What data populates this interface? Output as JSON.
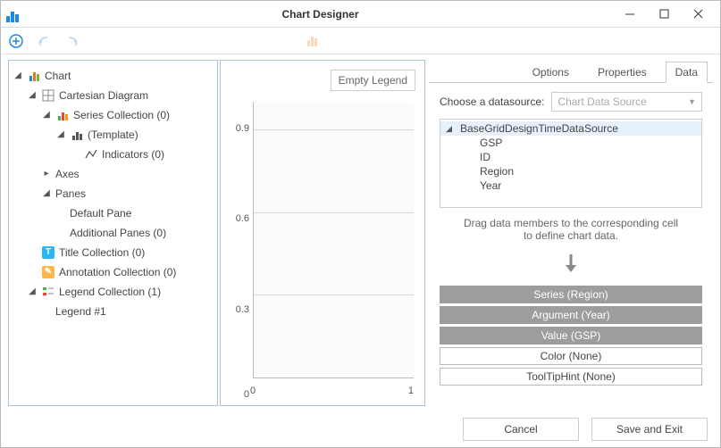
{
  "window": {
    "title": "Chart Designer"
  },
  "tree": {
    "chart": "Chart",
    "cartesian": "Cartesian Diagram",
    "series_collection": "Series Collection (0)",
    "template": "(Template)",
    "indicators": "Indicators (0)",
    "axes": "Axes",
    "panes": "Panes",
    "default_pane": "Default Pane",
    "additional_panes": "Additional Panes (0)",
    "title_collection": "Title Collection (0)",
    "annotation_collection": "Annotation Collection (0)",
    "legend_collection": "Legend Collection (1)",
    "legend1": "Legend #1"
  },
  "preview": {
    "legend": "Empty Legend"
  },
  "chart_data": {
    "type": "bar",
    "categories": [
      0,
      1
    ],
    "values": [],
    "xlabel": "",
    "ylabel": "",
    "xlim": [
      0,
      1
    ],
    "ylim": [
      0,
      1
    ],
    "yticks": [
      0,
      0.3,
      0.6,
      0.9
    ],
    "xticks": [
      0,
      1
    ]
  },
  "tabs": {
    "options": "Options",
    "properties": "Properties",
    "data": "Data"
  },
  "ds": {
    "label": "Choose a datasource:",
    "placeholder": "Chart Data Source",
    "root": "BaseGridDesignTimeDataSource",
    "fields": [
      "GSP",
      "ID",
      "Region",
      "Year"
    ]
  },
  "hint": {
    "line1": "Drag data members to the corresponding cell",
    "line2": "to define chart data."
  },
  "slots": {
    "series": "Series (Region)",
    "argument": "Argument (Year)",
    "value": "Value (GSP)",
    "color": "Color (None)",
    "tooltip": "ToolTipHint (None)"
  },
  "footer": {
    "cancel": "Cancel",
    "save": "Save and Exit"
  }
}
